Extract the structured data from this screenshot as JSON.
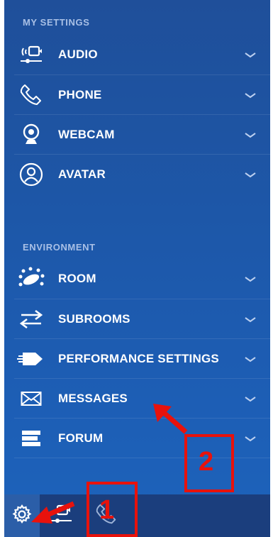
{
  "sections": {
    "my_settings": "MY SETTINGS",
    "environment": "ENVIRONMENT"
  },
  "my_settings_items": [
    {
      "label": "AUDIO",
      "icon": "audio-settings-icon"
    },
    {
      "label": "PHONE",
      "icon": "phone-icon"
    },
    {
      "label": "WEBCAM",
      "icon": "webcam-icon"
    },
    {
      "label": "AVATAR",
      "icon": "avatar-icon"
    }
  ],
  "environment_items": [
    {
      "label": "ROOM",
      "icon": "room-icon"
    },
    {
      "label": "SUBROOMS",
      "icon": "subrooms-icon"
    },
    {
      "label": "PERFORMANCE SETTINGS",
      "icon": "performance-icon"
    },
    {
      "label": "MESSAGES",
      "icon": "envelope-icon"
    },
    {
      "label": "FORUM",
      "icon": "forum-icon"
    }
  ],
  "annotations": {
    "one": "1",
    "two": "2"
  },
  "colors": {
    "panel_top": "#1f4f9a",
    "panel_bottom": "#1d63bb",
    "bottom_bar": "#1b3e7d",
    "annotation_red": "#e8120c",
    "section_title": "#a9c0e6"
  }
}
